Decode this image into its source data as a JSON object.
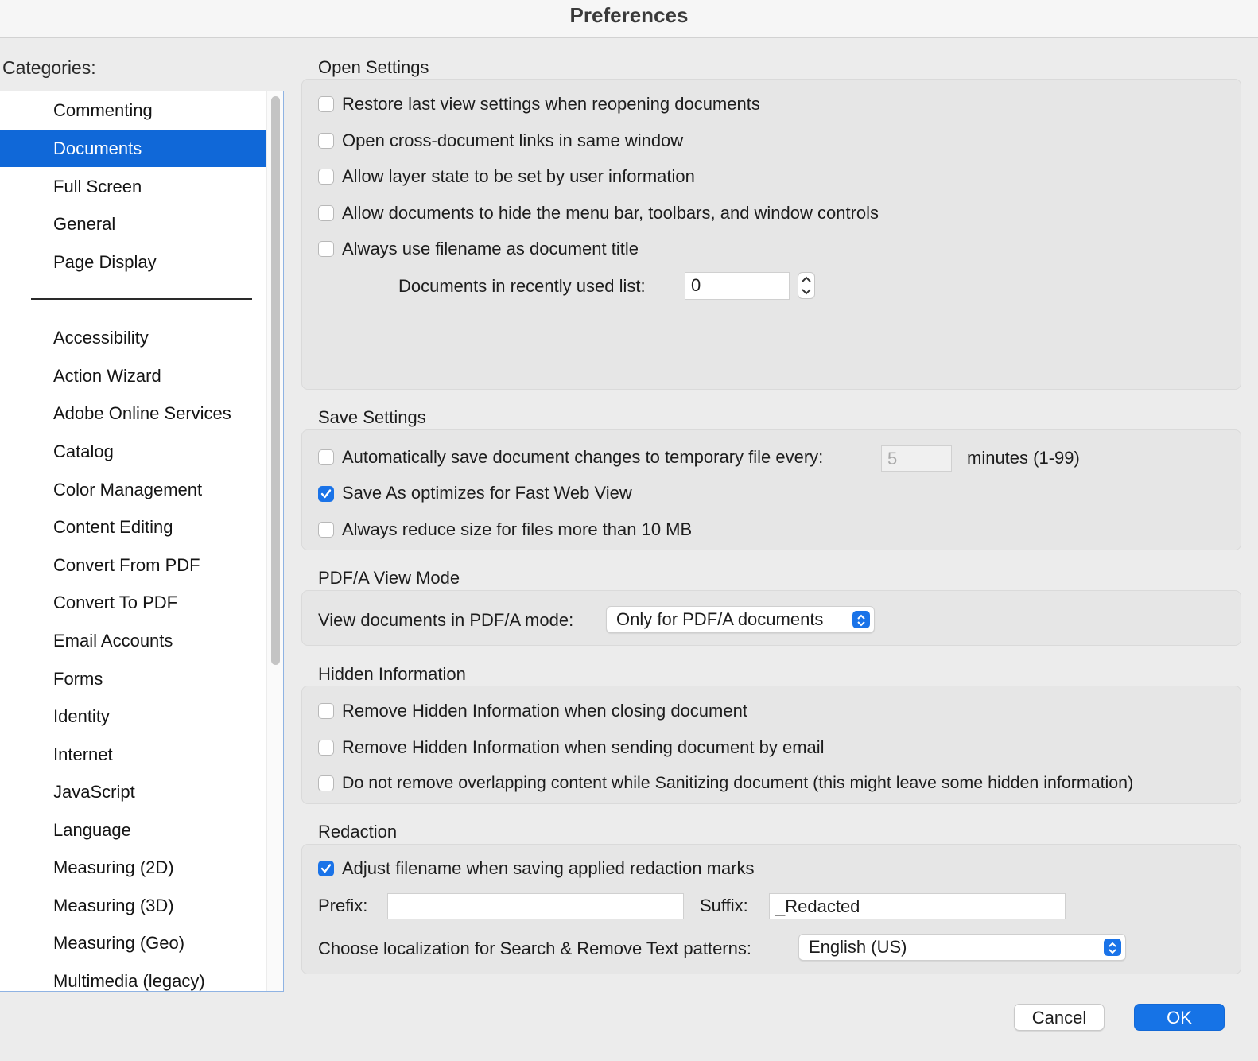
{
  "window": {
    "title": "Preferences"
  },
  "categories": {
    "label": "Categories:",
    "top_items": [
      "Commenting",
      "Documents",
      "Full Screen",
      "General",
      "Page Display"
    ],
    "selected": "Documents",
    "items": [
      "Accessibility",
      "Action Wizard",
      "Adobe Online Services",
      "Catalog",
      "Color Management",
      "Content Editing",
      "Convert From PDF",
      "Convert To PDF",
      "Email Accounts",
      "Forms",
      "Identity",
      "Internet",
      "JavaScript",
      "Language",
      "Measuring (2D)",
      "Measuring (3D)",
      "Measuring (Geo)",
      "Multimedia (legacy)"
    ]
  },
  "open_settings": {
    "title": "Open Settings",
    "options": [
      {
        "label": "Restore last view settings when reopening documents",
        "checked": false
      },
      {
        "label": "Open cross-document links in same window",
        "checked": false
      },
      {
        "label": "Allow layer state to be set by user information",
        "checked": false
      },
      {
        "label": "Allow documents to hide the menu bar, toolbars, and window controls",
        "checked": false
      },
      {
        "label": "Always use filename as document title",
        "checked": false
      }
    ],
    "recent_label": "Documents in recently used list:",
    "recent_value": "0"
  },
  "save_settings": {
    "title": "Save Settings",
    "autosave_label": "Automatically save document changes to temporary file every:",
    "autosave_checked": false,
    "autosave_value": "5",
    "autosave_unit": "minutes (1-99)",
    "options": [
      {
        "label": "Save As optimizes for Fast Web View",
        "checked": true
      },
      {
        "label": "Always reduce size for files more than 10 MB",
        "checked": false
      }
    ]
  },
  "pdfa": {
    "title": "PDF/A View Mode",
    "label": "View documents in PDF/A mode:",
    "selected": "Only for PDF/A documents"
  },
  "hidden_info": {
    "title": "Hidden Information",
    "options": [
      {
        "label": "Remove Hidden Information when closing document",
        "checked": false
      },
      {
        "label": "Remove Hidden Information when sending document by email",
        "checked": false
      },
      {
        "label": "Do not remove overlapping content while Sanitizing document (this might leave some hidden information)",
        "checked": false
      }
    ]
  },
  "redaction": {
    "title": "Redaction",
    "adjust_label": "Adjust filename when saving applied redaction marks",
    "adjust_checked": true,
    "prefix_label": "Prefix:",
    "prefix_value": "",
    "suffix_label": "Suffix:",
    "suffix_value": "_Redacted",
    "localization_label": "Choose localization for Search & Remove Text patterns:",
    "localization_selected": "English (US)"
  },
  "buttons": {
    "cancel": "Cancel",
    "ok": "OK"
  },
  "colors": {
    "accent": "#1068d8",
    "ok_button": "#1673e6",
    "checkbox_on": "#1a73e8"
  }
}
